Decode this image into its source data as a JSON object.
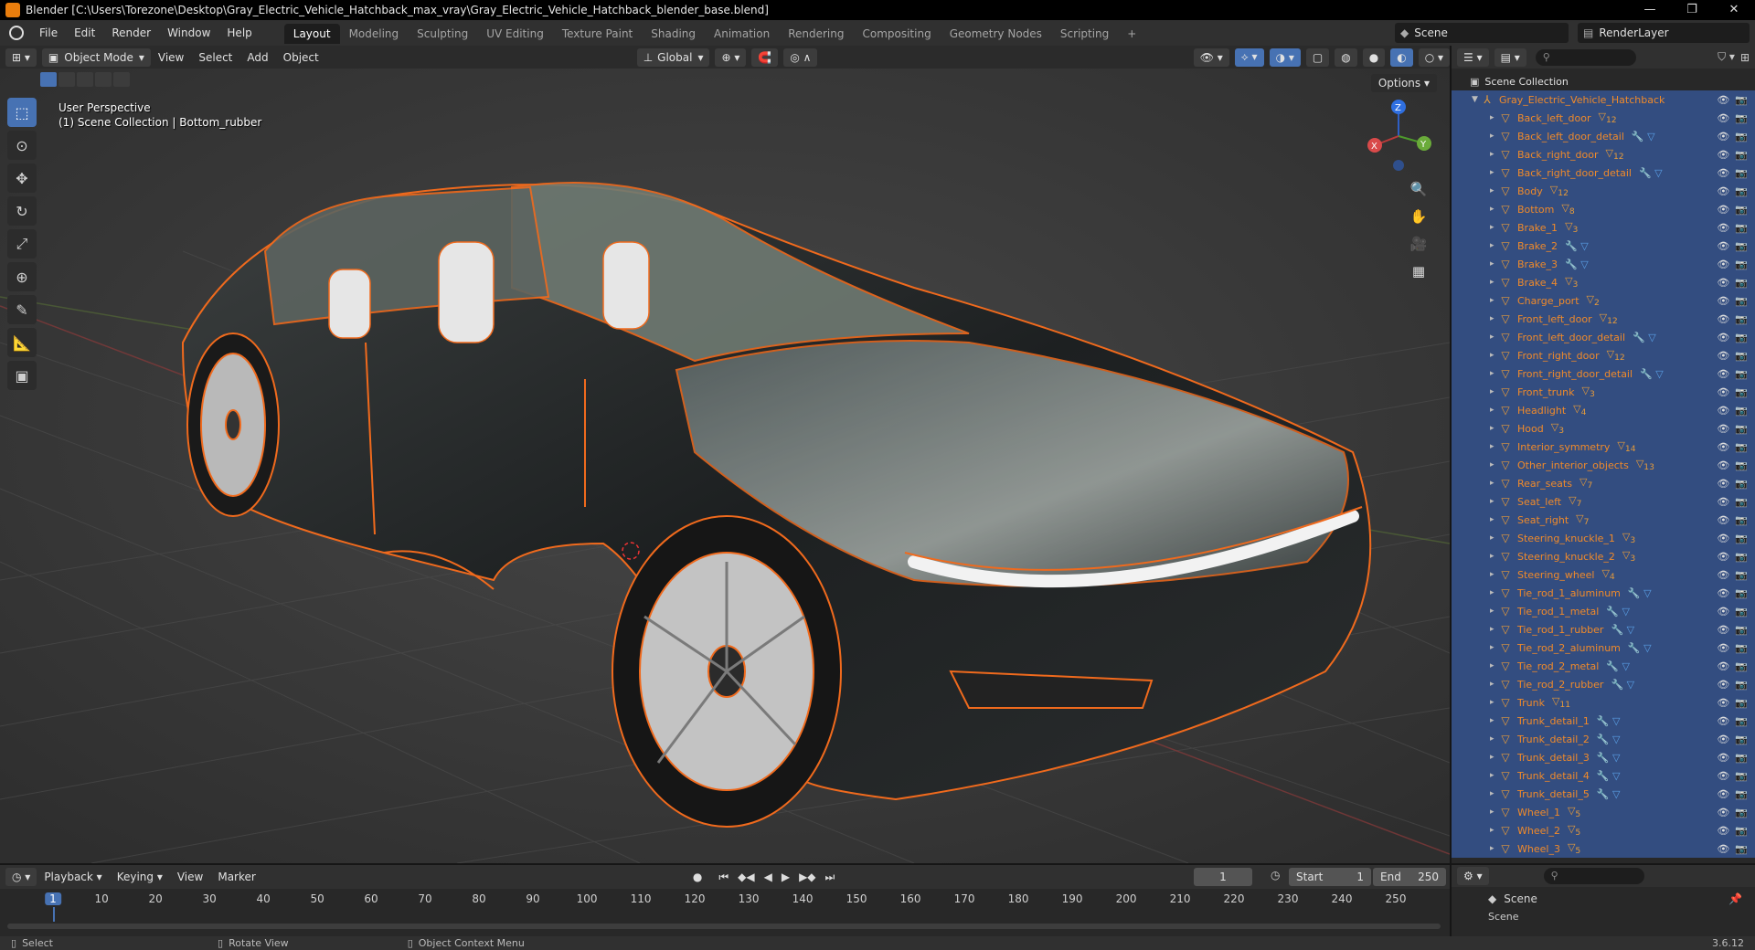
{
  "window": {
    "title": "Blender [C:\\Users\\Torezone\\Desktop\\Gray_Electric_Vehicle_Hatchback_max_vray\\Gray_Electric_Vehicle_Hatchback_blender_base.blend]",
    "controls": [
      "—",
      "❐",
      "✕"
    ]
  },
  "menubar": {
    "menus": [
      "File",
      "Edit",
      "Render",
      "Window",
      "Help"
    ],
    "workspaces": [
      "Layout",
      "Modeling",
      "Sculpting",
      "UV Editing",
      "Texture Paint",
      "Shading",
      "Animation",
      "Rendering",
      "Compositing",
      "Geometry Nodes",
      "Scripting",
      "+"
    ],
    "active_workspace": "Layout",
    "scene": "Scene",
    "view_layer": "RenderLayer"
  },
  "viewport_header": {
    "mode": "Object Mode",
    "menus": [
      "View",
      "Select",
      "Add",
      "Object"
    ],
    "orientation": "Global",
    "options": "Options"
  },
  "viewport": {
    "perspective": "User Perspective",
    "context": "(1) Scene Collection | Bottom_rubber",
    "gizmo": {
      "x": "X",
      "y": "Y",
      "z": "Z"
    }
  },
  "toolbar": {
    "tools": [
      "select-box",
      "cursor",
      "move",
      "rotate",
      "scale",
      "transform",
      "annotate",
      "measure",
      "add-cube"
    ]
  },
  "outliner": {
    "search_placeholder": "",
    "root": "Scene Collection",
    "collection": "Gray_Electric_Vehicle_Hatchback",
    "items": [
      {
        "name": "Back_left_door",
        "badge": "12",
        "mods": false
      },
      {
        "name": "Back_left_door_detail",
        "badge": "",
        "mods": true
      },
      {
        "name": "Back_right_door",
        "badge": "12",
        "mods": false
      },
      {
        "name": "Back_right_door_detail",
        "badge": "",
        "mods": true
      },
      {
        "name": "Body",
        "badge": "12",
        "mods": false
      },
      {
        "name": "Bottom",
        "badge": "8",
        "mods": false
      },
      {
        "name": "Brake_1",
        "badge": "3",
        "mods": false
      },
      {
        "name": "Brake_2",
        "badge": "",
        "mods": true
      },
      {
        "name": "Brake_3",
        "badge": "",
        "mods": true
      },
      {
        "name": "Brake_4",
        "badge": "3",
        "mods": false
      },
      {
        "name": "Charge_port",
        "badge": "2",
        "mods": false
      },
      {
        "name": "Front_left_door",
        "badge": "12",
        "mods": false
      },
      {
        "name": "Front_left_door_detail",
        "badge": "",
        "mods": true
      },
      {
        "name": "Front_right_door",
        "badge": "12",
        "mods": false
      },
      {
        "name": "Front_right_door_detail",
        "badge": "",
        "mods": true
      },
      {
        "name": "Front_trunk",
        "badge": "3",
        "mods": false
      },
      {
        "name": "Headlight",
        "badge": "4",
        "mods": false
      },
      {
        "name": "Hood",
        "badge": "3",
        "mods": false
      },
      {
        "name": "Interior_symmetry",
        "badge": "14",
        "mods": false
      },
      {
        "name": "Other_interior_objects",
        "badge": "13",
        "mods": false
      },
      {
        "name": "Rear_seats",
        "badge": "7",
        "mods": false
      },
      {
        "name": "Seat_left",
        "badge": "7",
        "mods": false
      },
      {
        "name": "Seat_right",
        "badge": "7",
        "mods": false
      },
      {
        "name": "Steering_knuckle_1",
        "badge": "3",
        "mods": false
      },
      {
        "name": "Steering_knuckle_2",
        "badge": "3",
        "mods": false
      },
      {
        "name": "Steering_wheel",
        "badge": "4",
        "mods": false
      },
      {
        "name": "Tie_rod_1_aluminum",
        "badge": "",
        "mods": true
      },
      {
        "name": "Tie_rod_1_metal",
        "badge": "",
        "mods": true
      },
      {
        "name": "Tie_rod_1_rubber",
        "badge": "",
        "mods": true
      },
      {
        "name": "Tie_rod_2_aluminum",
        "badge": "",
        "mods": true
      },
      {
        "name": "Tie_rod_2_metal",
        "badge": "",
        "mods": true
      },
      {
        "name": "Tie_rod_2_rubber",
        "badge": "",
        "mods": true
      },
      {
        "name": "Trunk",
        "badge": "11",
        "mods": false
      },
      {
        "name": "Trunk_detail_1",
        "badge": "",
        "mods": true
      },
      {
        "name": "Trunk_detail_2",
        "badge": "",
        "mods": true
      },
      {
        "name": "Trunk_detail_3",
        "badge": "",
        "mods": true
      },
      {
        "name": "Trunk_detail_4",
        "badge": "",
        "mods": true
      },
      {
        "name": "Trunk_detail_5",
        "badge": "",
        "mods": true
      },
      {
        "name": "Wheel_1",
        "badge": "5",
        "mods": false
      },
      {
        "name": "Wheel_2",
        "badge": "5",
        "mods": false
      },
      {
        "name": "Wheel_3",
        "badge": "5",
        "mods": false
      }
    ]
  },
  "properties": {
    "scene": "Scene",
    "partial": "Scene"
  },
  "timeline": {
    "menus": [
      "Playback",
      "Keying",
      "View",
      "Marker"
    ],
    "current_frame": "1",
    "start_label": "Start",
    "start": "1",
    "end_label": "End",
    "end": "250",
    "ticks": [
      "1",
      "10",
      "20",
      "30",
      "40",
      "50",
      "60",
      "70",
      "80",
      "90",
      "100",
      "110",
      "120",
      "130",
      "140",
      "150",
      "160",
      "170",
      "180",
      "190",
      "200",
      "210",
      "220",
      "230",
      "240",
      "250"
    ]
  },
  "statusbar": {
    "select": "Select",
    "rotate": "Rotate View",
    "context_menu": "Object Context Menu",
    "version": "3.6.12"
  },
  "colors": {
    "selection_outline": "#f06a1d",
    "active_tool": "#4772b3",
    "outliner_selected": "#334d80"
  }
}
